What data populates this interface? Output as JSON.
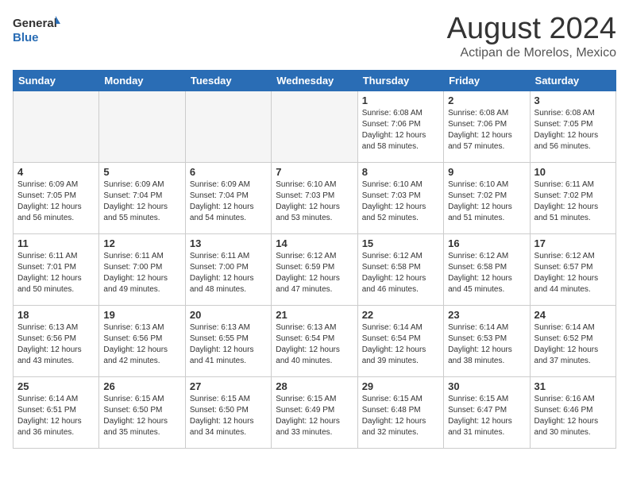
{
  "header": {
    "logo_general": "General",
    "logo_blue": "Blue",
    "month_year": "August 2024",
    "location": "Actipan de Morelos, Mexico"
  },
  "days_of_week": [
    "Sunday",
    "Monday",
    "Tuesday",
    "Wednesday",
    "Thursday",
    "Friday",
    "Saturday"
  ],
  "weeks": [
    [
      {
        "day": "",
        "info": ""
      },
      {
        "day": "",
        "info": ""
      },
      {
        "day": "",
        "info": ""
      },
      {
        "day": "",
        "info": ""
      },
      {
        "day": "1",
        "info": "Sunrise: 6:08 AM\nSunset: 7:06 PM\nDaylight: 12 hours\nand 58 minutes."
      },
      {
        "day": "2",
        "info": "Sunrise: 6:08 AM\nSunset: 7:06 PM\nDaylight: 12 hours\nand 57 minutes."
      },
      {
        "day": "3",
        "info": "Sunrise: 6:08 AM\nSunset: 7:05 PM\nDaylight: 12 hours\nand 56 minutes."
      }
    ],
    [
      {
        "day": "4",
        "info": "Sunrise: 6:09 AM\nSunset: 7:05 PM\nDaylight: 12 hours\nand 56 minutes."
      },
      {
        "day": "5",
        "info": "Sunrise: 6:09 AM\nSunset: 7:04 PM\nDaylight: 12 hours\nand 55 minutes."
      },
      {
        "day": "6",
        "info": "Sunrise: 6:09 AM\nSunset: 7:04 PM\nDaylight: 12 hours\nand 54 minutes."
      },
      {
        "day": "7",
        "info": "Sunrise: 6:10 AM\nSunset: 7:03 PM\nDaylight: 12 hours\nand 53 minutes."
      },
      {
        "day": "8",
        "info": "Sunrise: 6:10 AM\nSunset: 7:03 PM\nDaylight: 12 hours\nand 52 minutes."
      },
      {
        "day": "9",
        "info": "Sunrise: 6:10 AM\nSunset: 7:02 PM\nDaylight: 12 hours\nand 51 minutes."
      },
      {
        "day": "10",
        "info": "Sunrise: 6:11 AM\nSunset: 7:02 PM\nDaylight: 12 hours\nand 51 minutes."
      }
    ],
    [
      {
        "day": "11",
        "info": "Sunrise: 6:11 AM\nSunset: 7:01 PM\nDaylight: 12 hours\nand 50 minutes."
      },
      {
        "day": "12",
        "info": "Sunrise: 6:11 AM\nSunset: 7:00 PM\nDaylight: 12 hours\nand 49 minutes."
      },
      {
        "day": "13",
        "info": "Sunrise: 6:11 AM\nSunset: 7:00 PM\nDaylight: 12 hours\nand 48 minutes."
      },
      {
        "day": "14",
        "info": "Sunrise: 6:12 AM\nSunset: 6:59 PM\nDaylight: 12 hours\nand 47 minutes."
      },
      {
        "day": "15",
        "info": "Sunrise: 6:12 AM\nSunset: 6:58 PM\nDaylight: 12 hours\nand 46 minutes."
      },
      {
        "day": "16",
        "info": "Sunrise: 6:12 AM\nSunset: 6:58 PM\nDaylight: 12 hours\nand 45 minutes."
      },
      {
        "day": "17",
        "info": "Sunrise: 6:12 AM\nSunset: 6:57 PM\nDaylight: 12 hours\nand 44 minutes."
      }
    ],
    [
      {
        "day": "18",
        "info": "Sunrise: 6:13 AM\nSunset: 6:56 PM\nDaylight: 12 hours\nand 43 minutes."
      },
      {
        "day": "19",
        "info": "Sunrise: 6:13 AM\nSunset: 6:56 PM\nDaylight: 12 hours\nand 42 minutes."
      },
      {
        "day": "20",
        "info": "Sunrise: 6:13 AM\nSunset: 6:55 PM\nDaylight: 12 hours\nand 41 minutes."
      },
      {
        "day": "21",
        "info": "Sunrise: 6:13 AM\nSunset: 6:54 PM\nDaylight: 12 hours\nand 40 minutes."
      },
      {
        "day": "22",
        "info": "Sunrise: 6:14 AM\nSunset: 6:54 PM\nDaylight: 12 hours\nand 39 minutes."
      },
      {
        "day": "23",
        "info": "Sunrise: 6:14 AM\nSunset: 6:53 PM\nDaylight: 12 hours\nand 38 minutes."
      },
      {
        "day": "24",
        "info": "Sunrise: 6:14 AM\nSunset: 6:52 PM\nDaylight: 12 hours\nand 37 minutes."
      }
    ],
    [
      {
        "day": "25",
        "info": "Sunrise: 6:14 AM\nSunset: 6:51 PM\nDaylight: 12 hours\nand 36 minutes."
      },
      {
        "day": "26",
        "info": "Sunrise: 6:15 AM\nSunset: 6:50 PM\nDaylight: 12 hours\nand 35 minutes."
      },
      {
        "day": "27",
        "info": "Sunrise: 6:15 AM\nSunset: 6:50 PM\nDaylight: 12 hours\nand 34 minutes."
      },
      {
        "day": "28",
        "info": "Sunrise: 6:15 AM\nSunset: 6:49 PM\nDaylight: 12 hours\nand 33 minutes."
      },
      {
        "day": "29",
        "info": "Sunrise: 6:15 AM\nSunset: 6:48 PM\nDaylight: 12 hours\nand 32 minutes."
      },
      {
        "day": "30",
        "info": "Sunrise: 6:15 AM\nSunset: 6:47 PM\nDaylight: 12 hours\nand 31 minutes."
      },
      {
        "day": "31",
        "info": "Sunrise: 6:16 AM\nSunset: 6:46 PM\nDaylight: 12 hours\nand 30 minutes."
      }
    ]
  ]
}
